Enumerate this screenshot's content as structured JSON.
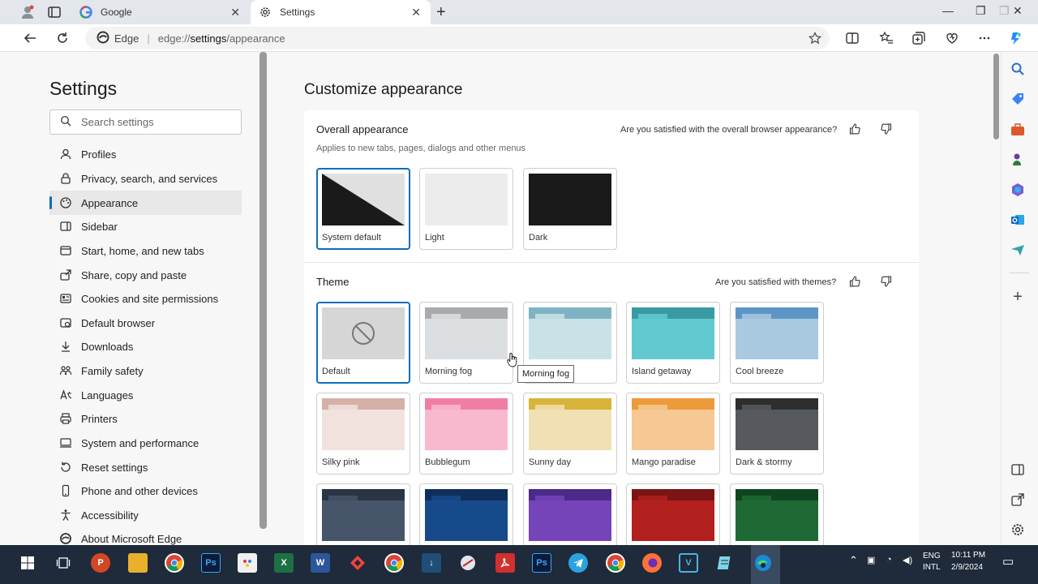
{
  "tabs": {
    "inactive_title": "Google",
    "active_title": "Settings"
  },
  "address_bar": {
    "site_label": "Edge",
    "url_prefix": "edge://",
    "url_main": "settings",
    "url_suffix": "/appearance"
  },
  "nav": {
    "title": "Settings",
    "search_placeholder": "Search settings",
    "items": [
      {
        "label": "Profiles",
        "icon": "profile-icon"
      },
      {
        "label": "Privacy, search, and services",
        "icon": "lock-icon"
      },
      {
        "label": "Appearance",
        "icon": "appearance-icon"
      },
      {
        "label": "Sidebar",
        "icon": "sidebar-icon"
      },
      {
        "label": "Start, home, and new tabs",
        "icon": "home-icon"
      },
      {
        "label": "Share, copy and paste",
        "icon": "share-icon"
      },
      {
        "label": "Cookies and site permissions",
        "icon": "cookies-icon"
      },
      {
        "label": "Default browser",
        "icon": "browser-icon"
      },
      {
        "label": "Downloads",
        "icon": "download-icon"
      },
      {
        "label": "Family safety",
        "icon": "family-icon"
      },
      {
        "label": "Languages",
        "icon": "languages-icon"
      },
      {
        "label": "Printers",
        "icon": "printer-icon"
      },
      {
        "label": "System and performance",
        "icon": "system-icon"
      },
      {
        "label": "Reset settings",
        "icon": "reset-icon"
      },
      {
        "label": "Phone and other devices",
        "icon": "phone-icon"
      },
      {
        "label": "Accessibility",
        "icon": "accessibility-icon"
      },
      {
        "label": "About Microsoft Edge",
        "icon": "edge-icon"
      }
    ]
  },
  "main": {
    "title": "Customize appearance",
    "overall": {
      "title": "Overall appearance",
      "subtitle": "Applies to new tabs, pages, dialogs and other menus",
      "feedback": "Are you satisfied with the overall browser appearance?",
      "options": [
        {
          "label": "System default",
          "selected": true
        },
        {
          "label": "Light",
          "selected": false
        },
        {
          "label": "Dark",
          "selected": false
        }
      ]
    },
    "theme": {
      "title": "Theme",
      "feedback": "Are you satisfied with themes?",
      "tooltip": "Morning fog",
      "options": [
        {
          "label": "Default",
          "top": "#b5b5b5",
          "body": "#d6d6d6",
          "selected": true
        },
        {
          "label": "Morning fog",
          "top": "#a8abae",
          "body": "#dcdfe1",
          "selected": false
        },
        {
          "label": "",
          "top": "#7fb3c4",
          "body": "#c9e2e8",
          "selected": false
        },
        {
          "label": "Island getaway",
          "top": "#3a9aa3",
          "body": "#62c9d1",
          "selected": false
        },
        {
          "label": "Cool breeze",
          "top": "#5d96c6",
          "body": "#a9c9e0",
          "selected": false
        },
        {
          "label": "Silky pink",
          "top": "#d4b0a6",
          "body": "#f1e2dd",
          "selected": false
        },
        {
          "label": "Bubblegum",
          "top": "#f07ea4",
          "body": "#f8b9cf",
          "selected": false
        },
        {
          "label": "Sunny day",
          "top": "#d9b43a",
          "body": "#f1e0b3",
          "selected": false
        },
        {
          "label": "Mango paradise",
          "top": "#ed9a3a",
          "body": "#f6c893",
          "selected": false
        },
        {
          "label": "Dark & stormy",
          "top": "#2e2e2e",
          "body": "#565a5e",
          "selected": false
        },
        {
          "label": "",
          "top": "#2a3445",
          "body": "#465569",
          "selected": false
        },
        {
          "label": "",
          "top": "#0e2f5c",
          "body": "#164a8a",
          "selected": false
        },
        {
          "label": "",
          "top": "#4b2a8a",
          "body": "#7544b8",
          "selected": false
        },
        {
          "label": "",
          "top": "#7b1414",
          "body": "#b21f1f",
          "selected": false
        },
        {
          "label": "",
          "top": "#0f4420",
          "body": "#1f6a34",
          "selected": false
        }
      ]
    }
  },
  "taskbar": {
    "lang_top": "ENG",
    "lang_bottom": "INTL",
    "time": "10:11 PM",
    "date": "2/9/2024"
  },
  "colors": {
    "accent": "#0f6cbd",
    "taskbar": "#1f2a3a"
  }
}
